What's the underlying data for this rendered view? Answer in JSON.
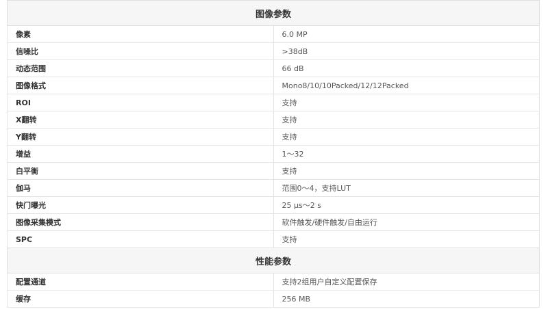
{
  "section1": {
    "title": "图像参数",
    "rows": [
      {
        "k": "像素",
        "v": "6.0 MP"
      },
      {
        "k": "信噪比",
        "v": ">38dB"
      },
      {
        "k": "动态范围",
        "v": "66 dB"
      },
      {
        "k": "图像格式",
        "v": "Mono8/10/10Packed/12/12Packed"
      },
      {
        "k": "ROI",
        "v": "支持"
      },
      {
        "k": "X翻转",
        "v": "支持"
      },
      {
        "k": "Y翻转",
        "v": "支持"
      },
      {
        "k": "增益",
        "v": "1～32"
      },
      {
        "k": "白平衡",
        "v": "支持"
      },
      {
        "k": "伽马",
        "v": "范围0～4，支持LUT"
      },
      {
        "k": "快门曝光",
        "v": "25 μs～2 s"
      },
      {
        "k": "图像采集模式",
        "v": "软件触发/硬件触发/自由运行"
      },
      {
        "k": "SPC",
        "v": "支持"
      }
    ]
  },
  "section2": {
    "title": "性能参数",
    "rows": [
      {
        "k": "配置通道",
        "v": "支持2组用户自定义配置保存"
      },
      {
        "k": "缓存",
        "v": "256 MB"
      }
    ]
  }
}
